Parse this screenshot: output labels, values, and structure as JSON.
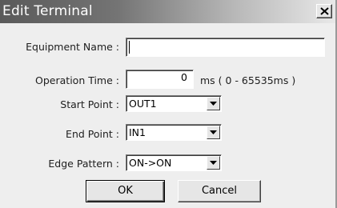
{
  "window": {
    "title": "Edit Terminal",
    "close_label": "×"
  },
  "form": {
    "equipment_name": {
      "label": "Equipment Name :",
      "value": ""
    },
    "operation_time": {
      "label": "Operation Time :",
      "value": "0",
      "unit": "ms ( 0 - 65535ms )"
    },
    "start_point": {
      "label": "Start Point :",
      "value": "OUT1"
    },
    "end_point": {
      "label": "End Point :",
      "value": "IN1"
    },
    "edge_pattern": {
      "label": "Edge Pattern :",
      "value": "ON->ON"
    }
  },
  "buttons": {
    "ok_label": "OK",
    "cancel_label": "Cancel"
  },
  "icons": {
    "close": "close-icon",
    "dropdown": "chevron-down-icon"
  }
}
